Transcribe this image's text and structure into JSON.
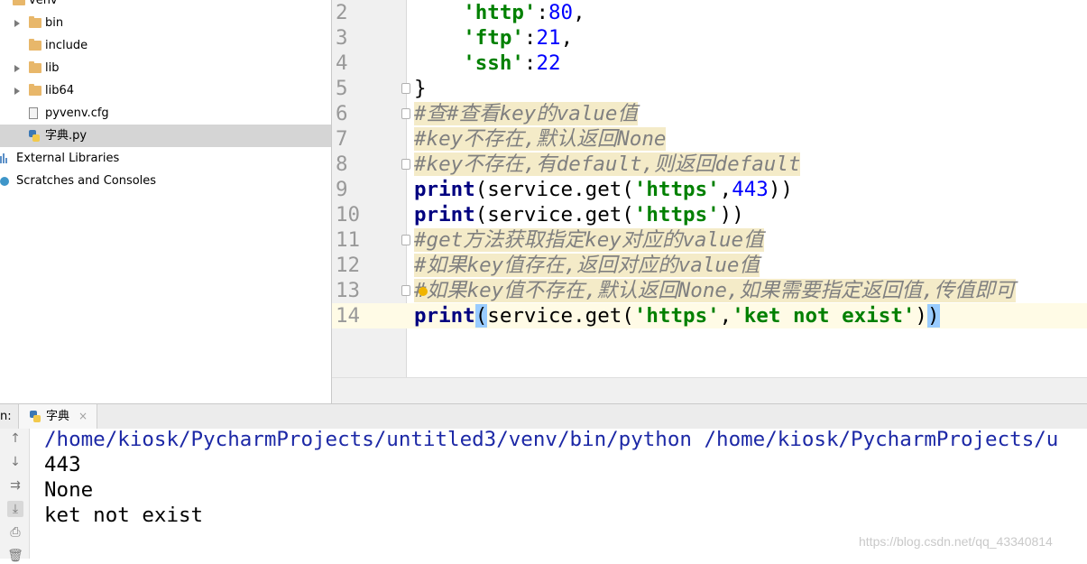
{
  "project_tree": {
    "items": [
      {
        "label": "venv",
        "icon": "folder-icon",
        "expandable": true,
        "expanded": true
      },
      {
        "label": "bin",
        "icon": "folder-icon",
        "expandable": true
      },
      {
        "label": "include",
        "icon": "folder-icon",
        "expandable": false
      },
      {
        "label": "lib",
        "icon": "folder-icon",
        "expandable": true
      },
      {
        "label": "lib64",
        "icon": "folder-link-icon",
        "expandable": true
      },
      {
        "label": "pyvenv.cfg",
        "icon": "file-icon"
      },
      {
        "label": "字典.py",
        "icon": "python-file-icon",
        "selected": true
      },
      {
        "label": "External Libraries",
        "icon": "library-icon"
      },
      {
        "label": "Scratches and Consoles",
        "icon": "scratches-icon"
      }
    ]
  },
  "editor": {
    "lines": [
      {
        "num": "2",
        "tokens": [
          {
            "t": "    ",
            "c": ""
          },
          {
            "t": "'http'",
            "c": "str"
          },
          {
            "t": ":",
            "c": ""
          },
          {
            "t": "80",
            "c": "num"
          },
          {
            "t": ",",
            "c": ""
          }
        ]
      },
      {
        "num": "3",
        "tokens": [
          {
            "t": "    ",
            "c": ""
          },
          {
            "t": "'ftp'",
            "c": "str"
          },
          {
            "t": ":",
            "c": ""
          },
          {
            "t": "21",
            "c": "num"
          },
          {
            "t": ",",
            "c": ""
          }
        ]
      },
      {
        "num": "4",
        "tokens": [
          {
            "t": "    ",
            "c": ""
          },
          {
            "t": "'ssh'",
            "c": "str"
          },
          {
            "t": ":",
            "c": ""
          },
          {
            "t": "22",
            "c": "num"
          }
        ]
      },
      {
        "num": "5",
        "fold": true,
        "tokens": [
          {
            "t": "}",
            "c": ""
          }
        ]
      },
      {
        "num": "6",
        "fold": true,
        "tokens": [
          {
            "t": "#查#查看key的value值",
            "c": "cm"
          }
        ]
      },
      {
        "num": "7",
        "tokens": [
          {
            "t": "#key不存在,默认返回None",
            "c": "cm"
          }
        ]
      },
      {
        "num": "8",
        "fold": true,
        "tokens": [
          {
            "t": "#key不存在,有default,则返回default",
            "c": "cm"
          }
        ]
      },
      {
        "num": "9",
        "tokens": [
          {
            "t": "print",
            "c": "kw"
          },
          {
            "t": "(service.get(",
            "c": ""
          },
          {
            "t": "'https'",
            "c": "str"
          },
          {
            "t": ",",
            "c": ""
          },
          {
            "t": "443",
            "c": "num"
          },
          {
            "t": "))",
            "c": ""
          }
        ]
      },
      {
        "num": "10",
        "tokens": [
          {
            "t": "print",
            "c": "kw"
          },
          {
            "t": "(service.get(",
            "c": ""
          },
          {
            "t": "'https'",
            "c": "str"
          },
          {
            "t": "))",
            "c": ""
          }
        ]
      },
      {
        "num": "11",
        "fold": true,
        "tokens": [
          {
            "t": "#get方法获取指定key对应的value值",
            "c": "cm"
          }
        ]
      },
      {
        "num": "12",
        "tokens": [
          {
            "t": "#如果key值存在,返回对应的value值",
            "c": "cm"
          }
        ]
      },
      {
        "num": "13",
        "fold": true,
        "tokens": [
          {
            "t": "#如果key值不存在,默认返回None,如果需要指定返回值,传值即可",
            "c": "cm"
          }
        ]
      },
      {
        "num": "14",
        "current": true,
        "tokens": [
          {
            "t": "print",
            "c": "kw"
          },
          {
            "t": "(",
            "c": "brk"
          },
          {
            "t": "service.get(",
            "c": ""
          },
          {
            "t": "'https'",
            "c": "str"
          },
          {
            "t": ",",
            "c": ""
          },
          {
            "t": "'ket not exist'",
            "c": "str"
          },
          {
            "t": ")",
            "c": ""
          },
          {
            "t": ")",
            "c": "brk"
          }
        ]
      }
    ]
  },
  "run_panel": {
    "label": "n:",
    "tab_label": "字典",
    "close_glyph": "×",
    "toolbar": [
      {
        "name": "scroll-up-icon",
        "glyph": "↑"
      },
      {
        "name": "scroll-down-icon",
        "glyph": "↓"
      },
      {
        "name": "soft-wrap-icon",
        "glyph": "⇉"
      },
      {
        "name": "scroll-to-end-icon",
        "glyph": "⤓",
        "active": true
      },
      {
        "name": "print-icon",
        "glyph": "⎙"
      },
      {
        "name": "trash-icon",
        "glyph": "🗑"
      }
    ],
    "output": [
      {
        "text": "/home/kiosk/PycharmProjects/untitled3/venv/bin/python /home/kiosk/PycharmProjects/u",
        "kind": "cmd"
      },
      {
        "text": "443",
        "kind": "out"
      },
      {
        "text": "None",
        "kind": "out"
      },
      {
        "text": "ket not exist",
        "kind": "out"
      }
    ]
  },
  "watermark": "https://blog.csdn.net/qq_43340814",
  "colors": {
    "keyword": "#000080",
    "string": "#008000",
    "number": "#0000ff",
    "comment_bg": "#f4ebc8",
    "selection": "#d5d5d5"
  }
}
